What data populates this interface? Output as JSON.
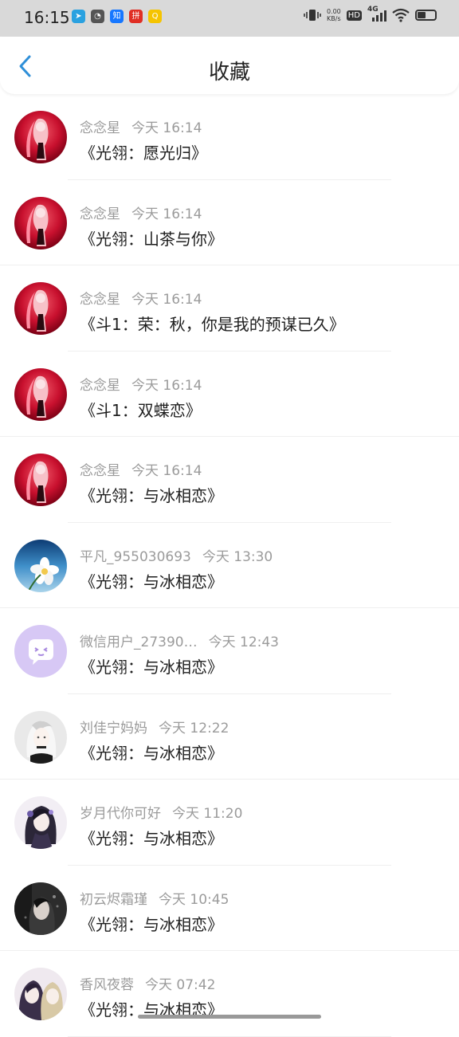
{
  "status_bar": {
    "time": "16:15",
    "net_speed_value": "0.00",
    "net_speed_unit": "KB/s",
    "hd": "HD",
    "network": "4G",
    "app_icons": [
      {
        "name": "telegram-icon",
        "color": "#2aa1e0",
        "glyph": "➤"
      },
      {
        "name": "clock-app-icon",
        "color": "#555555",
        "glyph": "◔"
      },
      {
        "name": "zhihu-icon",
        "color": "#1677ff",
        "glyph": "知"
      },
      {
        "name": "pdd-icon",
        "color": "#e02e24",
        "glyph": "拼"
      },
      {
        "name": "uc-icon",
        "color": "#f5c400",
        "glyph": "Q"
      }
    ],
    "battery_level": 0.45
  },
  "header": {
    "title": "收藏",
    "accent_color": "#2f8fd8"
  },
  "items": [
    {
      "author": "念念星",
      "time": "今天 16:14",
      "title": "《光翎：愿光归》",
      "avatar": "red-anime-avatar"
    },
    {
      "author": "念念星",
      "time": "今天 16:14",
      "title": "《光翎：山茶与你》",
      "avatar": "red-anime-avatar"
    },
    {
      "author": "念念星",
      "time": "今天 16:14",
      "title": "《斗1：荣：秋，你是我的预谋已久》",
      "avatar": "red-anime-avatar"
    },
    {
      "author": "念念星",
      "time": "今天 16:14",
      "title": "《斗1：双蝶恋》",
      "avatar": "red-anime-avatar"
    },
    {
      "author": "念念星",
      "time": "今天 16:14",
      "title": "《光翎：与冰相恋》",
      "avatar": "red-anime-avatar"
    },
    {
      "author": "平凡_955030693",
      "time": "今天 13:30",
      "title": "《光翎：与冰相恋》",
      "avatar": "flower-sky-avatar"
    },
    {
      "author": "微信用户_27390…",
      "time": "今天 12:43",
      "title": "《光翎：与冰相恋》",
      "avatar": "default-wechat-avatar"
    },
    {
      "author": "刘佳宁妈妈",
      "time": "今天 12:22",
      "title": "《光翎：与冰相恋》",
      "avatar": "white-hair-anime-avatar"
    },
    {
      "author": "岁月代你可好",
      "time": "今天 11:20",
      "title": "《光翎：与冰相恋》",
      "avatar": "dark-hair-anime-avatar"
    },
    {
      "author": "初云烬霜瑾",
      "time": "今天 10:45",
      "title": "《光翎：与冰相恋》",
      "avatar": "dark-portrait-avatar"
    },
    {
      "author": "香风夜蓉",
      "time": "今天 07:42",
      "title": "《光翎：与冰相恋》",
      "avatar": "couple-anime-avatar"
    }
  ]
}
